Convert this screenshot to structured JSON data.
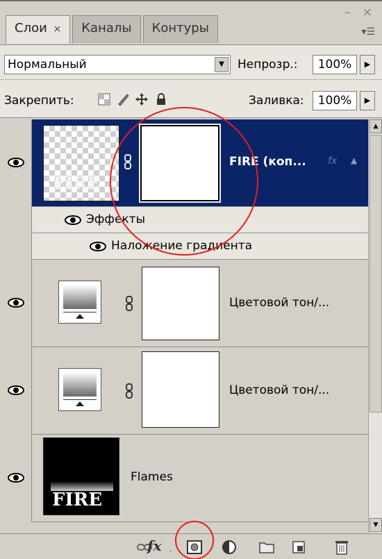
{
  "window_controls": "– ×",
  "tabs": [
    {
      "label": "Слои",
      "close": "×",
      "active": true
    },
    {
      "label": "Каналы",
      "active": false
    },
    {
      "label": "Контуры",
      "active": false
    }
  ],
  "blend": {
    "mode": "Нормальный",
    "opacity_label": "Непрозр.:",
    "opacity": "100%"
  },
  "lock": {
    "label": "Закрепить:",
    "fill_label": "Заливка:",
    "fill": "100%"
  },
  "layers": [
    {
      "name": "FIRE (коп...",
      "thumb_text": "FIRE",
      "selected": true
    },
    {
      "name": "Цветовой тон/...",
      "selected": false
    },
    {
      "name": "Цветовой тон/...",
      "selected": false
    },
    {
      "name": "Flames",
      "thumb_text": "FIRE",
      "selected": false
    }
  ],
  "effects": {
    "label": "Эффекты",
    "gradient_overlay": "Наложение градиента"
  },
  "toolbar_icons": [
    "link-icon",
    "fx-icon",
    "add-mask-icon",
    "adjustment-layer-icon",
    "new-group-icon",
    "new-layer-icon",
    "trash-icon"
  ],
  "fx_label": "fx",
  "colors": {
    "selection": "#0a2467",
    "highlight_circle": "#e02020",
    "panel": "#d4d0c8"
  }
}
